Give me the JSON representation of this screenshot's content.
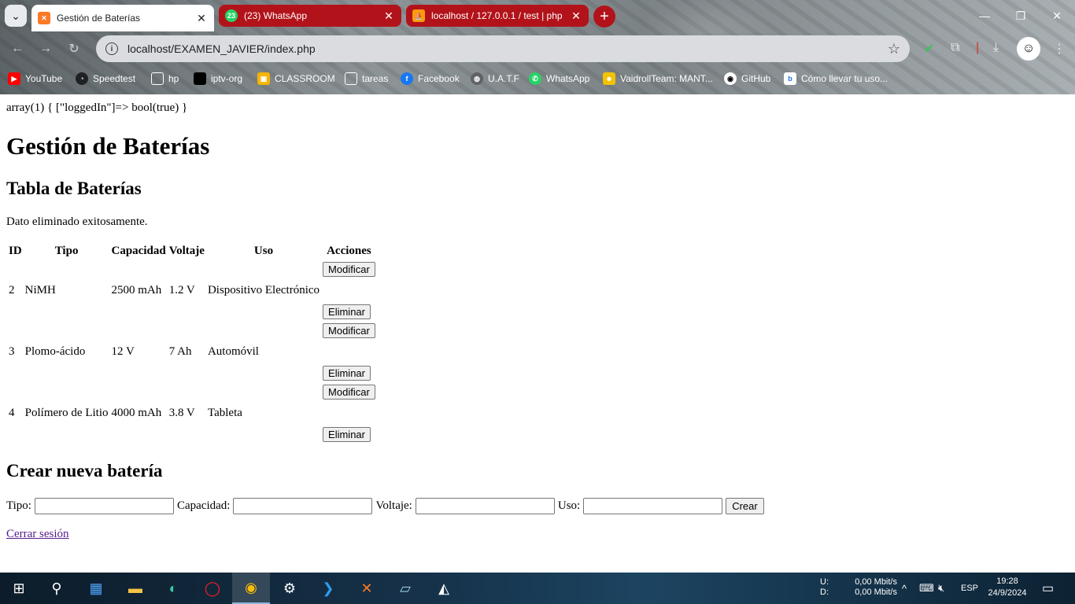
{
  "browser": {
    "tabs": [
      {
        "title": "Gestión de Baterías",
        "active": true
      },
      {
        "title": "(23) WhatsApp",
        "badge": "23",
        "active": false
      },
      {
        "title": "localhost / 127.0.0.1 / test | php",
        "active": false
      }
    ],
    "url": "localhost/EXAMEN_JAVIER/index.php",
    "bookmarks": [
      "YouTube",
      "Speedtest",
      "hp",
      "iptv-org",
      "CLASSROOM",
      "tareas",
      "Facebook",
      "U.A.T.F",
      "WhatsApp",
      "VaidrollTeam: MANT...",
      "GitHub",
      "Cómo llevar tu uso..."
    ],
    "colors": {
      "tab_accent": "#b2131a"
    }
  },
  "page": {
    "dump": "array(1) { [\"loggedIn\"]=> bool(true) }",
    "title": "Gestión de Baterías",
    "table_heading": "Tabla de Baterías",
    "message": "Dato eliminado exitosamente.",
    "columns": [
      "ID",
      "Tipo",
      "Capacidad",
      "Voltaje",
      "Uso",
      "Acciones"
    ],
    "rows": [
      {
        "id": "2",
        "tipo": "NiMH",
        "capacidad": "2500 mAh",
        "voltaje": "1.2 V",
        "uso": "Dispositivo Electrónico"
      },
      {
        "id": "3",
        "tipo": "Plomo-ácido",
        "capacidad": "12 V",
        "voltaje": "7 Ah",
        "uso": "Automóvil"
      },
      {
        "id": "4",
        "tipo": "Polímero de Litio",
        "capacidad": "4000 mAh",
        "voltaje": "3.8 V",
        "uso": "Tableta"
      }
    ],
    "modify_label": "Modificar",
    "delete_label": "Eliminar",
    "create_heading": "Crear nueva batería",
    "form": {
      "tipo_label": "Tipo:",
      "capacidad_label": "Capacidad:",
      "voltaje_label": "Voltaje:",
      "uso_label": "Uso:",
      "submit_label": "Crear"
    },
    "logout_label": "Cerrar sesión"
  },
  "taskbar": {
    "net_labels": [
      "U:",
      "D:"
    ],
    "net_values": [
      "0,00 Mbit/s",
      "0,00 Mbit/s"
    ],
    "language": "ESP",
    "time": "19:28",
    "date": "24/9/2024"
  }
}
